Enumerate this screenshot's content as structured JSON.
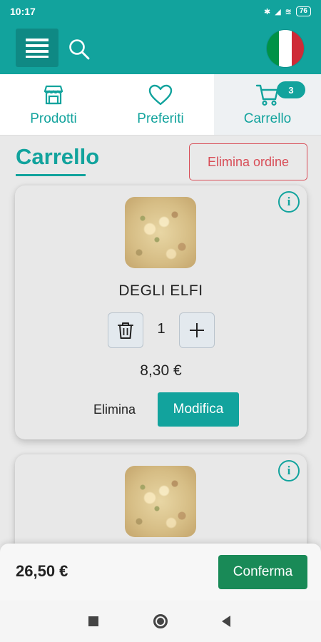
{
  "status": {
    "time": "10:17",
    "battery": "76"
  },
  "header": {
    "menu_icon": "hamburger-menu-icon",
    "search_icon": "search-icon",
    "language": "Italiano",
    "flag_colors": [
      "#009246",
      "#ffffff",
      "#ce2b37"
    ]
  },
  "tabs": [
    {
      "label": "Prodotti",
      "icon": "store-icon"
    },
    {
      "label": "Preferiti",
      "icon": "heart-icon"
    },
    {
      "label": "Carrello",
      "icon": "cart-icon",
      "badge": "3",
      "active": true
    }
  ],
  "page": {
    "title": "Carrello",
    "delete_order_label": "Elimina ordine"
  },
  "cart_items": [
    {
      "name": "DEGLI ELFI",
      "quantity": "1",
      "price": "8,30 €",
      "remove_label": "Elimina",
      "edit_label": "Modifica",
      "image": "focaccia"
    },
    {
      "name": "",
      "image": "focaccia"
    }
  ],
  "summary": {
    "total": "26,50 €",
    "confirm_label": "Conferma"
  },
  "colors": {
    "primary": "#12a39d",
    "danger": "#d84d57",
    "confirm": "#198a57"
  }
}
